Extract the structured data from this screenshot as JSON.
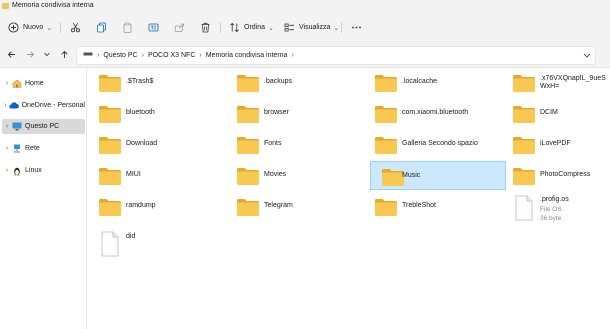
{
  "window": {
    "title": "Memoria condivisa interna"
  },
  "toolbar": {
    "new_label": "Nuovo",
    "sort_label": "Ordina",
    "view_label": "Visualizza",
    "icons": [
      "plus-icon",
      "cut-icon",
      "copy-icon",
      "paste-icon",
      "rename-icon",
      "share-icon",
      "delete-icon",
      "sort-icon",
      "view-icon",
      "more-icon"
    ]
  },
  "address": {
    "crumbs": [
      "Questo PC",
      "POCO X3 NFC",
      "Memoria condivisa interna"
    ]
  },
  "nav": {
    "items": [
      {
        "label": "Home",
        "icon": "home-icon",
        "selected": false
      },
      {
        "label": "OneDrive - Personal",
        "icon": "cloud-icon",
        "selected": false
      },
      {
        "label": "Questo PC",
        "icon": "computer-icon",
        "selected": true
      },
      {
        "label": "Rete",
        "icon": "network-icon",
        "selected": false
      },
      {
        "label": "Linux",
        "icon": "linux-icon",
        "selected": false
      }
    ]
  },
  "items": [
    {
      "name": ".$Trash$",
      "type": "folder"
    },
    {
      "name": ".backups",
      "type": "folder"
    },
    {
      "name": ".localcache",
      "type": "folder"
    },
    {
      "name": ".x76VXQnapIL_9ueSWxH=",
      "type": "folder"
    },
    {
      "name": "bluetooth",
      "type": "folder"
    },
    {
      "name": "browser",
      "type": "folder"
    },
    {
      "name": "com.xiaomi.bluetooth",
      "type": "folder"
    },
    {
      "name": "DCIM",
      "type": "folder"
    },
    {
      "name": "Download",
      "type": "folder"
    },
    {
      "name": "Fonts",
      "type": "folder"
    },
    {
      "name": "Galleria Secondo spazio",
      "type": "folder"
    },
    {
      "name": "iLovePDF",
      "type": "folder"
    },
    {
      "name": "MIUI",
      "type": "folder"
    },
    {
      "name": "Movies",
      "type": "folder"
    },
    {
      "name": "Music",
      "type": "folder",
      "selected": true
    },
    {
      "name": "PhotoCompress",
      "type": "folder"
    },
    {
      "name": "ramdump",
      "type": "folder"
    },
    {
      "name": "Telegram",
      "type": "folder"
    },
    {
      "name": "TrebleShot",
      "type": "folder"
    },
    {
      "name": ".profig.os",
      "type": "file",
      "kind": "File OS",
      "size": "36 byte"
    },
    {
      "name": "did",
      "type": "file"
    }
  ],
  "colors": {
    "folder": "#f8c851",
    "folder_dark": "#e6a92c",
    "selection": "#cce8ff",
    "nav_selected": "#d9d9d9",
    "accent": "#0067c0"
  }
}
